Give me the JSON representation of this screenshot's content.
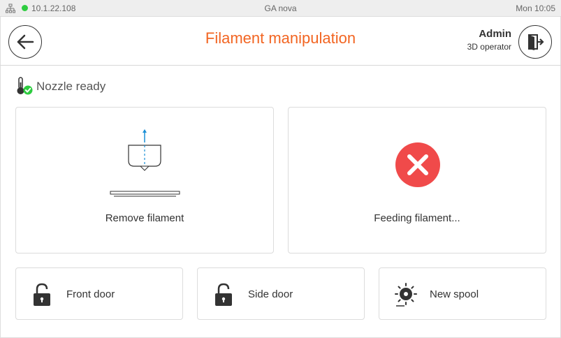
{
  "statusbar": {
    "ip": "10.1.22.108",
    "printer_name": "GA nova",
    "time": "Mon 10:05",
    "connection_color": "#2ecc40"
  },
  "header": {
    "title": "Filament manipulation",
    "user_name": "Admin",
    "user_role": "3D operator",
    "back_icon": "arrow-left-icon",
    "logout_icon": "logout-door-icon",
    "accent_color": "#f26522"
  },
  "nozzle_status": {
    "text": "Nozzle ready",
    "icon": "thermometer-check-icon"
  },
  "actions": {
    "remove_label": "Remove filament",
    "feed_label": "Feeding filament...",
    "feed_state_icon": "error-x-icon",
    "error_color": "#f04a4a"
  },
  "quick_buttons": {
    "front_door": "Front door",
    "side_door": "Side door",
    "new_spool": "New spool"
  }
}
